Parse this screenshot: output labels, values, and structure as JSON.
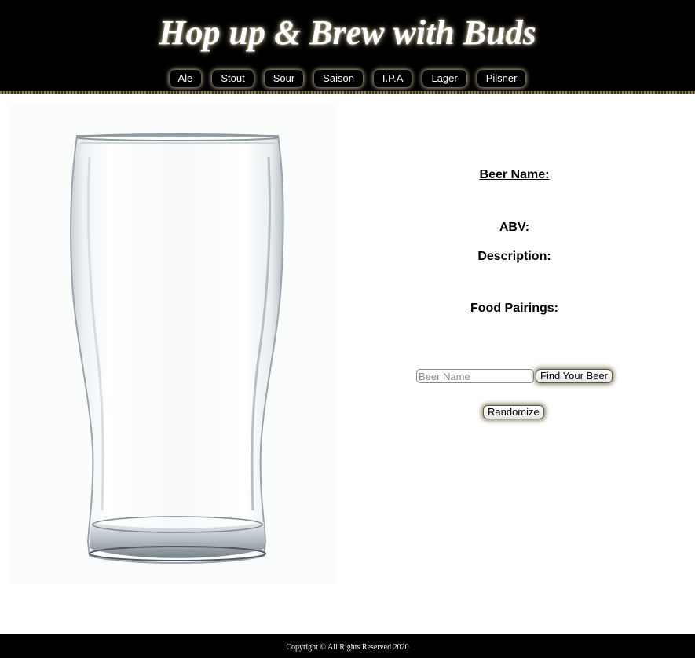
{
  "header": {
    "title": "Hop up & Brew with Buds",
    "nav": [
      "Ale",
      "Stout",
      "Sour",
      "Saison",
      "I.P.A",
      "Lager",
      "Pilsner"
    ]
  },
  "image": {
    "name": "empty-pint-glass"
  },
  "info": {
    "beer_name_label": "Beer Name:",
    "abv_label": "ABV:",
    "description_label": "Description:",
    "food_pairings_label": "Food Pairings:"
  },
  "search": {
    "placeholder": "Beer Name",
    "value": "",
    "find_button": "Find Your Beer",
    "randomize_button": "Randomize"
  },
  "footer": {
    "copyright": "Copyright © All Rights Reserved 2020"
  },
  "colors": {
    "header_bg": "#000000",
    "glow": "#fff5be",
    "page_bg": "#ffffff"
  }
}
